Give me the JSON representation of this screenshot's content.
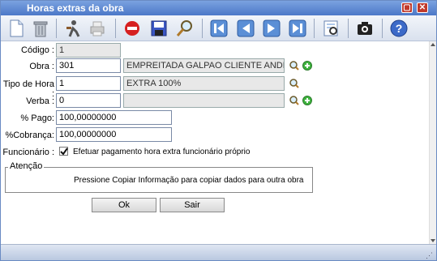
{
  "window": {
    "title": "Horas extras da obra"
  },
  "toolbar": {
    "tools": [
      "new-document-icon",
      "delete-icon",
      "worker-icon",
      "print-icon",
      "cancel-icon",
      "save-icon",
      "search-icon",
      "first-record-icon",
      "previous-record-icon",
      "next-record-icon",
      "last-record-icon",
      "report-icon",
      "camera-icon",
      "help-icon"
    ]
  },
  "form": {
    "codigo": {
      "label": "Código :",
      "value": "1"
    },
    "obra": {
      "label": "Obra :",
      "value": "301",
      "description": "EMPREITADA GALPAO CLIENTE ANDRE"
    },
    "tipo_hora": {
      "label": "Tipo de Hora :",
      "value": "1",
      "description": "EXTRA 100%"
    },
    "verba": {
      "label": "Verba :",
      "value": "0",
      "description": ""
    },
    "pago": {
      "label": "% Pago:",
      "value": "100,00000000"
    },
    "cobranca": {
      "label": "%Cobrança:",
      "value": "100,00000000"
    },
    "funcionario": {
      "label": "Funcionário :",
      "checkbox_label": "Efetuar pagamento hora extra funcionário próprio",
      "checked": true
    }
  },
  "atencao": {
    "legend": "Atenção",
    "text": "Pressione Copiar Informação para copiar dados para outra obra"
  },
  "buttons": {
    "ok": "Ok",
    "sair": "Sair"
  },
  "colors": {
    "titlebar": "#4c78c8",
    "close": "#c0392b"
  }
}
